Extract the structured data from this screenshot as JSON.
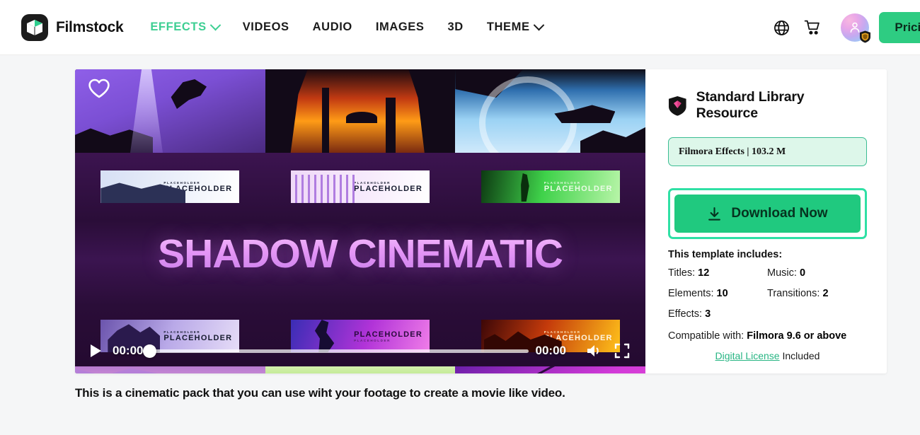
{
  "navbar": {
    "brand": "Filmstock",
    "logo_icon": "filmstock-cube-logo",
    "links": [
      {
        "label": "EFFECTS",
        "has_caret": true,
        "active": true
      },
      {
        "label": "VIDEOS",
        "has_caret": false,
        "active": false
      },
      {
        "label": "AUDIO",
        "has_caret": false,
        "active": false
      },
      {
        "label": "IMAGES",
        "has_caret": false,
        "active": false
      },
      {
        "label": "3D",
        "has_caret": false,
        "active": false
      },
      {
        "label": "THEME",
        "has_caret": true,
        "active": false
      }
    ],
    "language_icon": "globe-icon",
    "cart_icon": "shopping-cart-icon",
    "avatar_icon": "user-avatar",
    "avatar_badge_icon": "shield-badge-icon",
    "pricing_label": "Pricing"
  },
  "video": {
    "favorite_icon": "heart-icon",
    "title_art": "SHADOW CINEMATIC",
    "placeholder_small": "PLACEHOLDER",
    "placeholder_large": "PLACEHOLDER",
    "controls": {
      "play_icon": "play-icon",
      "current_time": "00:00",
      "duration": "00:00",
      "progress_percent": 0,
      "volume_icon": "volume-icon",
      "fullscreen_icon": "fullscreen-icon"
    }
  },
  "info": {
    "badge_icon": "diamond-shield-icon",
    "resource_type": "Standard Library Resource",
    "tag": "Filmora Effects | 103.2 M",
    "download": {
      "icon": "download-icon",
      "label": "Download Now"
    },
    "includes_title": "This template includes:",
    "specs": [
      {
        "label": "Titles:",
        "value": "12"
      },
      {
        "label": "Music:",
        "value": "0"
      },
      {
        "label": "Elements:",
        "value": "10"
      },
      {
        "label": "Transitions:",
        "value": "2"
      },
      {
        "label": "Effects:",
        "value": "3"
      }
    ],
    "compatible_label": "Compatible with:",
    "compatible_value": "Filmora 9.6 or above",
    "license_link": "Digital License",
    "license_suffix": "Included"
  },
  "description": "This is a cinematic pack that you can use wiht your footage to create a movie like video.",
  "colors": {
    "accent_green": "#3ecf93",
    "button_green": "#20c97f",
    "highlight_ring": "#2fe0a5",
    "tag_bg": "#ddf7ea",
    "tag_border": "#3bbd93",
    "page_bg": "#f5f6f7"
  }
}
